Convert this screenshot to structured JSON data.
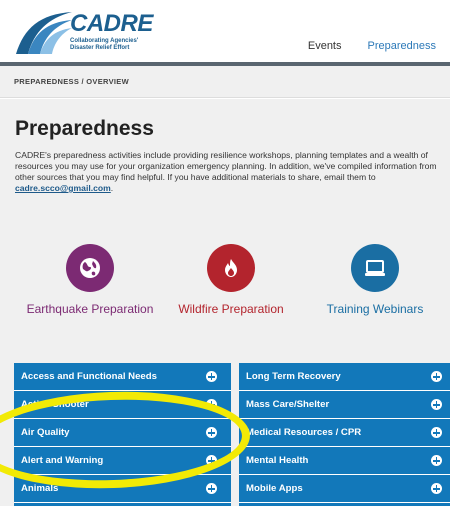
{
  "logo": {
    "text": "CADRE",
    "subtitle": "Collaborating Agencies' Disaster Relief Effort"
  },
  "nav": {
    "items": [
      "Events",
      "Preparedness"
    ],
    "active": "Preparedness"
  },
  "breadcrumb": "PREPAREDNESS / OVERVIEW",
  "page": {
    "title": "Preparedness",
    "intro": "CADRE's preparedness activities include providing resilience workshops, planning templates and a wealth of resources you may use for your organization emergency planning. In addition, we've compiled information from other sources that you may find helpful. If you have additional materials to share, email them to ",
    "email": "cadre.scco@gmail.com",
    "intro_end": "."
  },
  "features": [
    {
      "label": "Earthquake Preparation",
      "icon": "globe-icon",
      "color": "#7c2a73"
    },
    {
      "label": "Wildfire Preparation",
      "icon": "flame-icon",
      "color": "#b3242d"
    },
    {
      "label": "Training Webinars",
      "icon": "laptop-icon",
      "color": "#1a6ea3"
    }
  ],
  "left_list": [
    "Access and Functional Needs",
    "Active Shooter",
    "Air Quality",
    "Alert and Warning",
    "Animals",
    ""
  ],
  "right_list": [
    "Long Term Recovery",
    "Mass Care/Shelter",
    "Medical Resources / CPR",
    "Mental Health",
    "Mobile Apps",
    ""
  ],
  "colors": {
    "accordion": "#1278ba",
    "highlight": "#f2ea05",
    "header_bar": "#5a6670"
  }
}
